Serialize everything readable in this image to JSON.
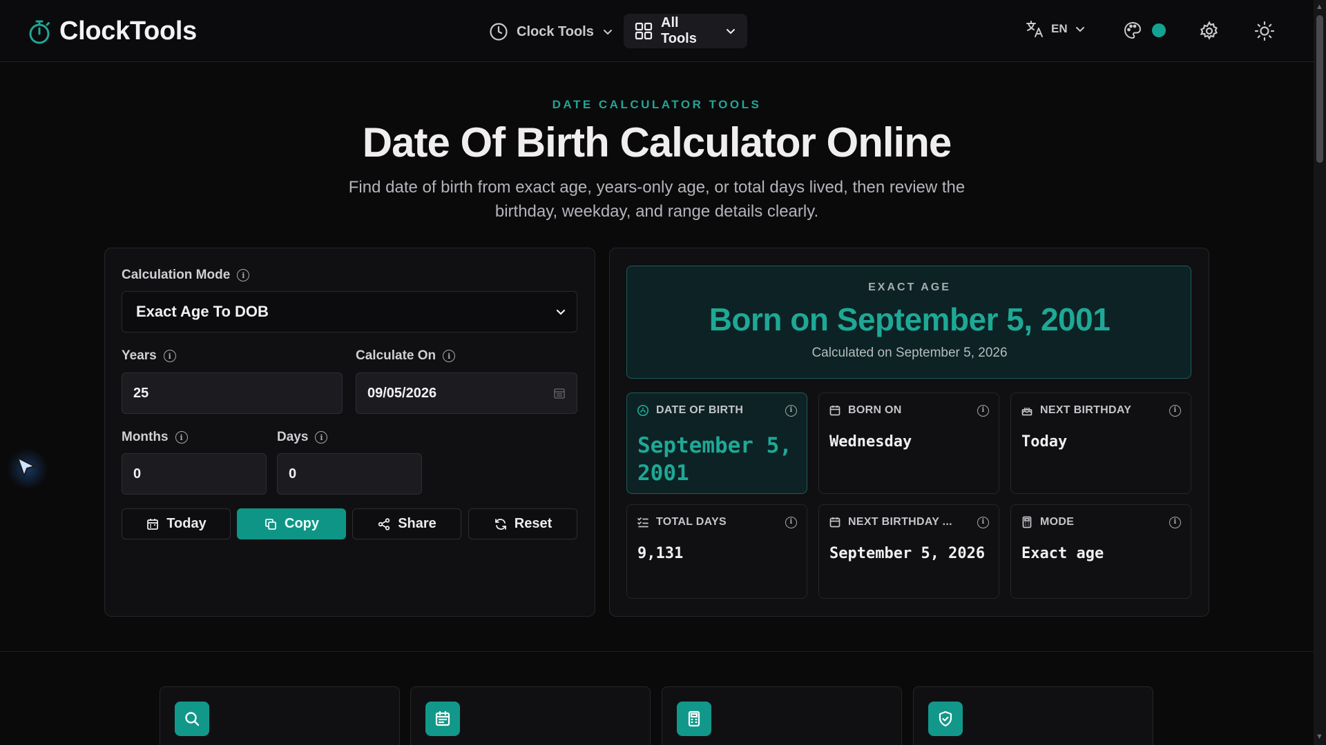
{
  "header": {
    "brand": "ClockTools",
    "nav_clock_tools": "Clock Tools",
    "nav_all_tools": "All Tools",
    "language": "EN",
    "accent_color": "#13a393"
  },
  "hero": {
    "eyebrow": "DATE CALCULATOR TOOLS",
    "title": "Date Of Birth Calculator Online",
    "subtitle_line1": "Find date of birth from exact age, years-only age, or total days lived, then review the",
    "subtitle_line2": "birthday, weekday, and range details clearly."
  },
  "form": {
    "mode_label": "Calculation Mode",
    "mode_value": "Exact Age To DOB",
    "years_label": "Years",
    "years_value": "25",
    "calculate_on_label": "Calculate On",
    "calculate_on_value": "09/05/2026",
    "months_label": "Months",
    "months_value": "0",
    "days_label": "Days",
    "days_value": "0",
    "buttons": {
      "today": "Today",
      "copy": "Copy",
      "share": "Share",
      "reset": "Reset"
    }
  },
  "result": {
    "eyebrow": "EXACT AGE",
    "headline": "Born on September 5, 2001",
    "calculated_on": "Calculated on September 5, 2026"
  },
  "stats": [
    {
      "label": "DATE OF BIRTH",
      "value": "September 5, 2001",
      "icon": "cake-icon"
    },
    {
      "label": "BORN ON",
      "value": "Wednesday",
      "icon": "calendar-icon"
    },
    {
      "label": "NEXT BIRTHDAY",
      "value": "Today",
      "icon": "gift-icon"
    },
    {
      "label": "TOTAL DAYS",
      "value": "9,131",
      "icon": "list-check-icon"
    },
    {
      "label": "NEXT BIRTHDAY ...",
      "value": "September 5, 2026",
      "icon": "calendar-icon"
    },
    {
      "label": "MODE",
      "value": "Exact age",
      "icon": "calculator-icon"
    }
  ],
  "feature_cards": [
    {
      "icon": "search-icon"
    },
    {
      "icon": "calendar-icon"
    },
    {
      "icon": "calculator-icon"
    },
    {
      "icon": "shield-check-icon"
    }
  ]
}
